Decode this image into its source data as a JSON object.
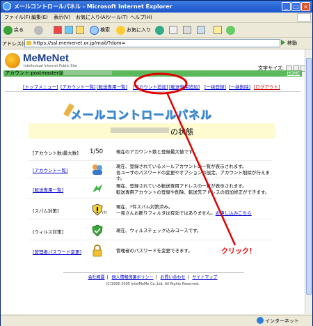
{
  "window": {
    "title": "メールコントロールパネル - Microsoft Internet Explorer",
    "buttons": [
      "_",
      "□",
      "×"
    ]
  },
  "menu": [
    "ファイル(F)",
    "編集(E)",
    "表示(V)",
    "お気に入り(A)",
    "ツール(T)",
    "ヘルプ(H)"
  ],
  "toolbar": {
    "back": "戻る",
    "search": "検索",
    "favorites": "お気に入り"
  },
  "address": {
    "label": "アドレス(D)",
    "url": "https://ssl.memenet.or.jp/mail/?dom=",
    "go": "移動"
  },
  "page": {
    "logo_name": "MeMeNet",
    "logo_sub": "Intellectual Internet Public Site",
    "font_size_label": "文字サイズ:",
    "account_label": "アカウント:postmaster@",
    "home": "HOME",
    "nav": [
      {
        "label": "[トップメニュー]",
        "red": false
      },
      {
        "label": "[アカウント一覧]",
        "red": false
      },
      {
        "label": "[転送専用一覧]",
        "red": false
      },
      {
        "label": "[アカウント追加]",
        "red": false
      },
      {
        "label": "[転送専用追加]",
        "red": false
      },
      {
        "label": "[一括登録]",
        "red": false
      },
      {
        "label": "[一括削除]",
        "red": false
      },
      {
        "label": "[ログアウト]",
        "red": true
      }
    ],
    "title": "メールコントロールパネル",
    "status_suffix": "の状態",
    "rows": [
      {
        "cat": "[アカウント数/最大数]",
        "link": false,
        "count": "1/50",
        "desc": [
          "現在のアカウント数と登録最大値です。"
        ]
      },
      {
        "cat": "[アカウント一覧]",
        "link": true,
        "desc": [
          "現在、登録されているメールアカウントの一覧が表示されます。",
          "各ユーザのパスワードの変更やオプションの設定、アカウント削除が行えます。"
        ]
      },
      {
        "cat": "[転送専用一覧]",
        "link": true,
        "desc": [
          "現在、登録されている転送専用アドレスの一覧が表示されます。",
          "転送専用アカウントの登録や削除、転送先アドレスの追加修正ができます。"
        ]
      },
      {
        "cat": "[スパム対策]",
        "link": false,
        "desc": [
          "現在、?件スパム対策済み。",
          "一見さんお断りフィルタは有効ではありません。"
        ],
        "desc_link": "お申し込みこちら",
        "icon_note": "(?)"
      },
      {
        "cat": "[ウィルス対策]",
        "link": false,
        "desc": [
          "現在、ウィルスチェック込みコースです。"
        ]
      },
      {
        "cat": "[管理者パスワード変更]",
        "link": true,
        "desc": [
          "管理者のパスワードを変更できます。"
        ]
      }
    ],
    "footer_links": [
      "会社概要",
      "個人情報保護ポリシー",
      "お問い合わせ",
      "サイトマップ"
    ],
    "copyright": "(C)1995-2005 IntelMeMe Co.,Ltd. All Rights Reserved."
  },
  "statusbar": {
    "zone": "インターネット"
  },
  "annotation": {
    "callout": "クリック！",
    "color": "#e00000"
  }
}
